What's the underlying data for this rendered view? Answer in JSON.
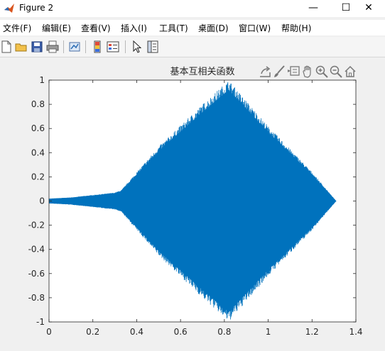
{
  "window": {
    "title": "Figure 2"
  },
  "window_controls": {
    "minimize": "—",
    "maximize": "☐",
    "close": "✕"
  },
  "menu": [
    "文件(F)",
    "编辑(E)",
    "查看(V)",
    "插入(I)",
    "工具(T)",
    "桌面(D)",
    "窗口(W)",
    "帮助(H)"
  ],
  "toolbar": [
    "new-figure-icon",
    "open-file-icon",
    "save-icon",
    "print-icon",
    "link-plot-icon",
    "insert-colorbar-icon",
    "insert-legend-icon",
    "edit-plot-icon",
    "property-inspector-icon"
  ],
  "axes_toolbar": [
    "export-icon",
    "brush-icon",
    "data-tips-icon",
    "pan-icon",
    "zoom-in-icon",
    "zoom-out-icon",
    "home-icon"
  ],
  "colors": {
    "series": "#0072bd",
    "axes": "#262626"
  },
  "chart_data": {
    "type": "line",
    "title": "基本互相关函数",
    "xlabel": "",
    "ylabel": "",
    "xlim": [
      0,
      1.4
    ],
    "ylim": [
      -1,
      1
    ],
    "xticks": [
      "0",
      "0.2",
      "0.4",
      "0.6",
      "0.8",
      "1",
      "1.2",
      "1.4"
    ],
    "yticks": [
      "1",
      "0.8",
      "0.6",
      "0.4",
      "0.2",
      "0",
      "-0.2",
      "-0.4",
      "-0.6",
      "-0.8",
      "-1"
    ],
    "grid": false,
    "legend": "none",
    "series": [
      {
        "values_description_free_envelope": true,
        "envelope": {
          "x": [
            0,
            0.1,
            0.2,
            0.3,
            0.33,
            0.5,
            0.7,
            0.82,
            1.0,
            1.2,
            1.31
          ],
          "upper": [
            0.02,
            0.03,
            0.05,
            0.07,
            0.09,
            0.45,
            0.8,
            1.0,
            0.62,
            0.24,
            0.0
          ],
          "lower": [
            -0.02,
            -0.03,
            -0.05,
            -0.07,
            -0.09,
            -0.45,
            -0.8,
            -1.0,
            -0.62,
            -0.24,
            0.0
          ]
        }
      }
    ]
  }
}
